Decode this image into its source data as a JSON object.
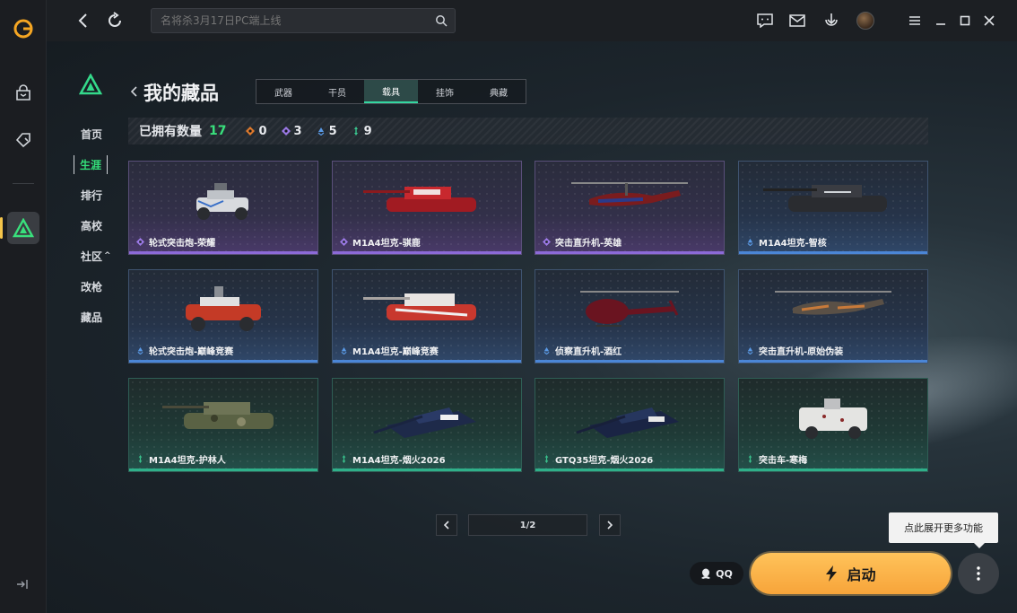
{
  "colors": {
    "accent_green": "#39e07c",
    "launch_orange": "#f7a43a",
    "rarity_purple": "#8c6ad8",
    "rarity_blue": "#4b86d6",
    "rarity_green": "#2fb08a",
    "rarity_orange": "#e07a2c"
  },
  "rail": {
    "icons": [
      "app-logo-icon",
      "store-icon",
      "gamepad-tag-icon",
      "game-icon",
      "collapse-icon"
    ]
  },
  "topbar": {
    "search_placeholder": "名将杀3月17日PC端上线",
    "icons": [
      "back-icon",
      "refresh-icon",
      "search-icon",
      "message-icon",
      "mail-icon",
      "download-icon",
      "menu-icon",
      "minimize-icon",
      "maximize-icon",
      "close-icon"
    ]
  },
  "nav": {
    "items": [
      "首页",
      "生涯",
      "排行",
      "高校",
      "社区",
      "改枪",
      "藏品"
    ],
    "active_index": 1,
    "community_caret": "^"
  },
  "page": {
    "title": "我的藏品",
    "tabs": [
      "武器",
      "干员",
      "载具",
      "挂饰",
      "典藏"
    ],
    "active_tab": 2
  },
  "stats": {
    "label": "已拥有数量",
    "total": "17",
    "counts": [
      {
        "rarity": "orange",
        "value": "0"
      },
      {
        "rarity": "purple",
        "value": "3"
      },
      {
        "rarity": "blue",
        "value": "5"
      },
      {
        "rarity": "green",
        "value": "9"
      }
    ]
  },
  "cards": [
    {
      "name": "轮式突击炮-荣耀",
      "rarity": "purple",
      "kind": "buggy"
    },
    {
      "name": "M1A4坦克-骐鹿",
      "rarity": "purple",
      "kind": "tank-red"
    },
    {
      "name": "突击直升机-英雄",
      "rarity": "purple",
      "kind": "heli-attack"
    },
    {
      "name": "M1A4坦克-智核",
      "rarity": "blue",
      "kind": "tank-black"
    },
    {
      "name": "轮式突击炮-巅峰竞赛",
      "rarity": "blue",
      "kind": "buggy-red"
    },
    {
      "name": "M1A4坦克-巅峰竞赛",
      "rarity": "blue",
      "kind": "tank-redwhite"
    },
    {
      "name": "侦察直升机-酒红",
      "rarity": "blue",
      "kind": "heli-scout"
    },
    {
      "name": "突击直升机-原始伪装",
      "rarity": "blue",
      "kind": "heli-camo"
    },
    {
      "name": "M1A4坦克-护林人",
      "rarity": "green",
      "kind": "tank-camo"
    },
    {
      "name": "M1A4坦克-烟火2026",
      "rarity": "green",
      "kind": "tank-navy"
    },
    {
      "name": "GTQ35坦克-烟火2026",
      "rarity": "green",
      "kind": "tank-navy2"
    },
    {
      "name": "突击车-寒梅",
      "rarity": "green",
      "kind": "apc-white"
    }
  ],
  "pager": {
    "label": "1/2",
    "current_page": 1,
    "total_pages": 2
  },
  "tooltip": {
    "text": "点此展开更多功能"
  },
  "qq": {
    "label": "QQ"
  },
  "launch": {
    "label": "启动"
  }
}
